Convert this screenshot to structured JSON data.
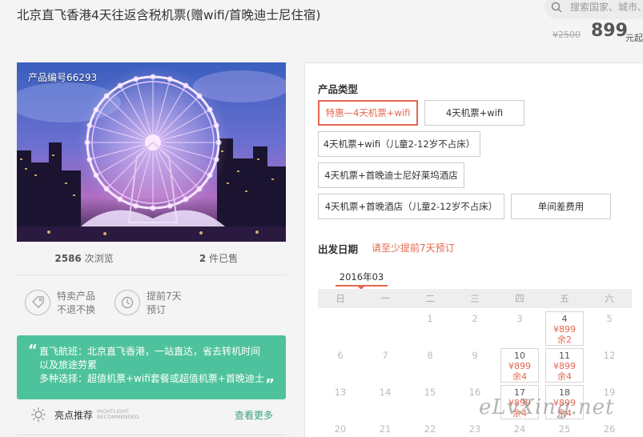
{
  "title": "北京直飞香港4天往返含税机票(赠wifi/首晚迪士尼住宿)",
  "search": {
    "placeholder": "搜索国家、城市、"
  },
  "price": {
    "original": "¥2500",
    "current": "899",
    "unit": "元起"
  },
  "product": {
    "number_label": "产品编号66293",
    "views_count": "2586",
    "views_label": "次浏览",
    "sold_count": "2",
    "sold_label": "件已售"
  },
  "features": [
    {
      "icon": "tag-icon",
      "line1": "特卖产品",
      "line2": "不退不换"
    },
    {
      "icon": "clock-icon",
      "line1": "提前7天",
      "line2": "预订"
    }
  ],
  "intro": {
    "line1": "直飞航班：北京直飞香港，一站直达，省去转机时间",
    "line2": "以及旅途劳累",
    "line3": "多种选择：超值机票+wifi套餐或超值机票+首晚迪士"
  },
  "highlight": {
    "title": "亮点推荐",
    "en_line1": "HIGHTLIGHT",
    "en_line2": "RECOMMENDED",
    "see_more": "查看更多"
  },
  "product_type": {
    "label": "产品类型",
    "options": [
      "特惠—4天机票+wifi",
      "4天机票+wifi",
      "4天机票+wifi（儿童2-12岁不占床）",
      "4天机票+首晚迪士尼好莱坞酒店",
      "4天机票+首晚酒店（儿童2-12岁不占床）",
      "单间差费用"
    ],
    "selected_index": 0
  },
  "departure": {
    "label": "出发日期",
    "hint": "请至少提前7天预订"
  },
  "calendar": {
    "month": "2016年03",
    "weekdays": [
      "日",
      "一",
      "二",
      "三",
      "四",
      "五",
      "六"
    ],
    "available": [
      {
        "day": "4",
        "price": "¥899",
        "remain": "余2"
      },
      {
        "day": "10",
        "price": "¥899",
        "remain": "余4"
      },
      {
        "day": "11",
        "price": "¥899",
        "remain": "余4"
      },
      {
        "day": "17",
        "price": "¥899",
        "remain": "余4"
      },
      {
        "day": "18",
        "price": "¥899",
        "remain": "余4"
      }
    ],
    "plain_days": [
      "1",
      "2",
      "3",
      "5",
      "6",
      "7",
      "8",
      "9",
      "12",
      "13",
      "14",
      "15",
      "16",
      "19",
      "20",
      "21",
      "22",
      "23",
      "24",
      "25",
      "26"
    ]
  },
  "watermark": "eLvXing.net",
  "colors": {
    "accent": "#e4684f",
    "green": "#4ec29d"
  }
}
